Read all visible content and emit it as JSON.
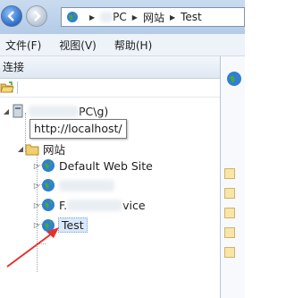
{
  "address_bar": {
    "crumbs": [
      "PC",
      "网站",
      "Test"
    ]
  },
  "menu": {
    "items": [
      "文件(F)",
      "视图(V)",
      "帮助(H)"
    ]
  },
  "connections": {
    "title": "连接",
    "server_suffix": "PC\\g)",
    "tooltip": "http://localhost/",
    "sites_label": "网站",
    "sites": [
      {
        "label": "Default Web Site"
      },
      {
        "label": ""
      },
      {
        "label": "vice",
        "prefix": "F."
      },
      {
        "label": "Test"
      }
    ]
  },
  "colors": {
    "arrow": "#e4322b",
    "selection": "#d9e8fb",
    "title_bar": "#c3d6ee"
  }
}
